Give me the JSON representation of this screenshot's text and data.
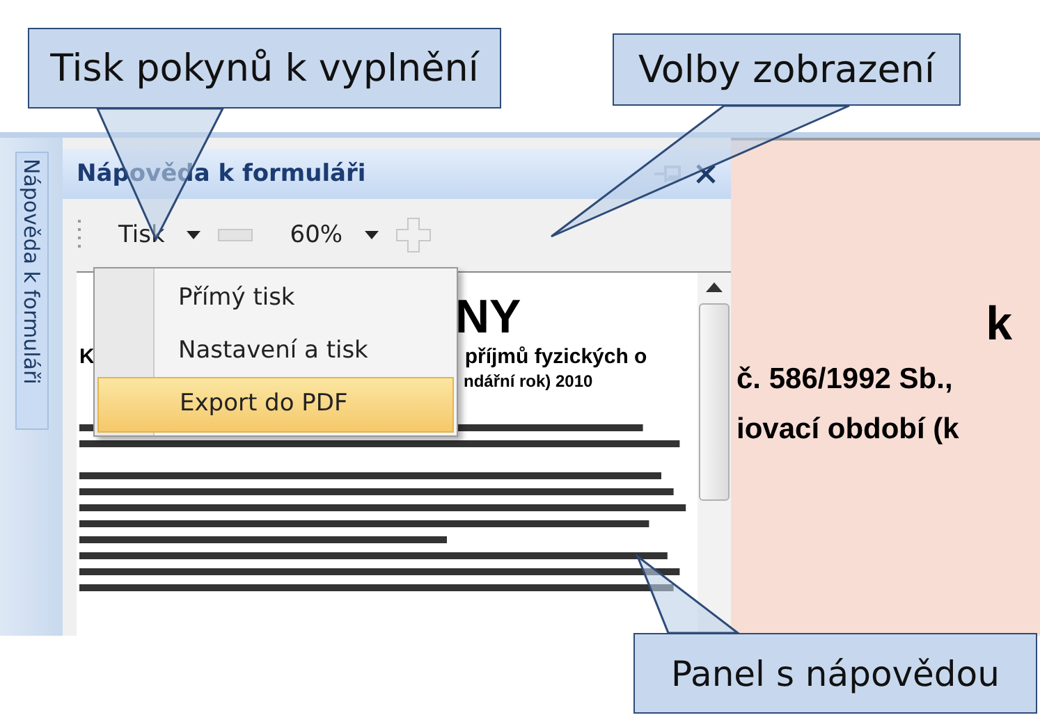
{
  "callouts": [
    {
      "text": "Tisk pokynů k vyplnění"
    },
    {
      "text": "Volby zobrazení"
    },
    {
      "text": "Panel s nápovědou"
    }
  ],
  "side_tab": {
    "label": "Nápověda k formuláři"
  },
  "panel": {
    "title": "Nápověda k formuláři",
    "toolbar": {
      "print": "Tisk",
      "zoom": "60%"
    },
    "menu": [
      {
        "label": "Přímý tisk",
        "selected": false
      },
      {
        "label": "Nastavení a tisk",
        "selected": false
      },
      {
        "label": "Export do PDF",
        "selected": true
      }
    ],
    "document": {
      "heading": "NY",
      "left_fragment": "K",
      "subtitle": "příjmů fyzických o",
      "year_line": "ndářní rok) 2010"
    }
  },
  "main_document": {
    "lines": [
      "k",
      "č. 586/1992 Sb.,",
      "iovací období (k"
    ]
  }
}
